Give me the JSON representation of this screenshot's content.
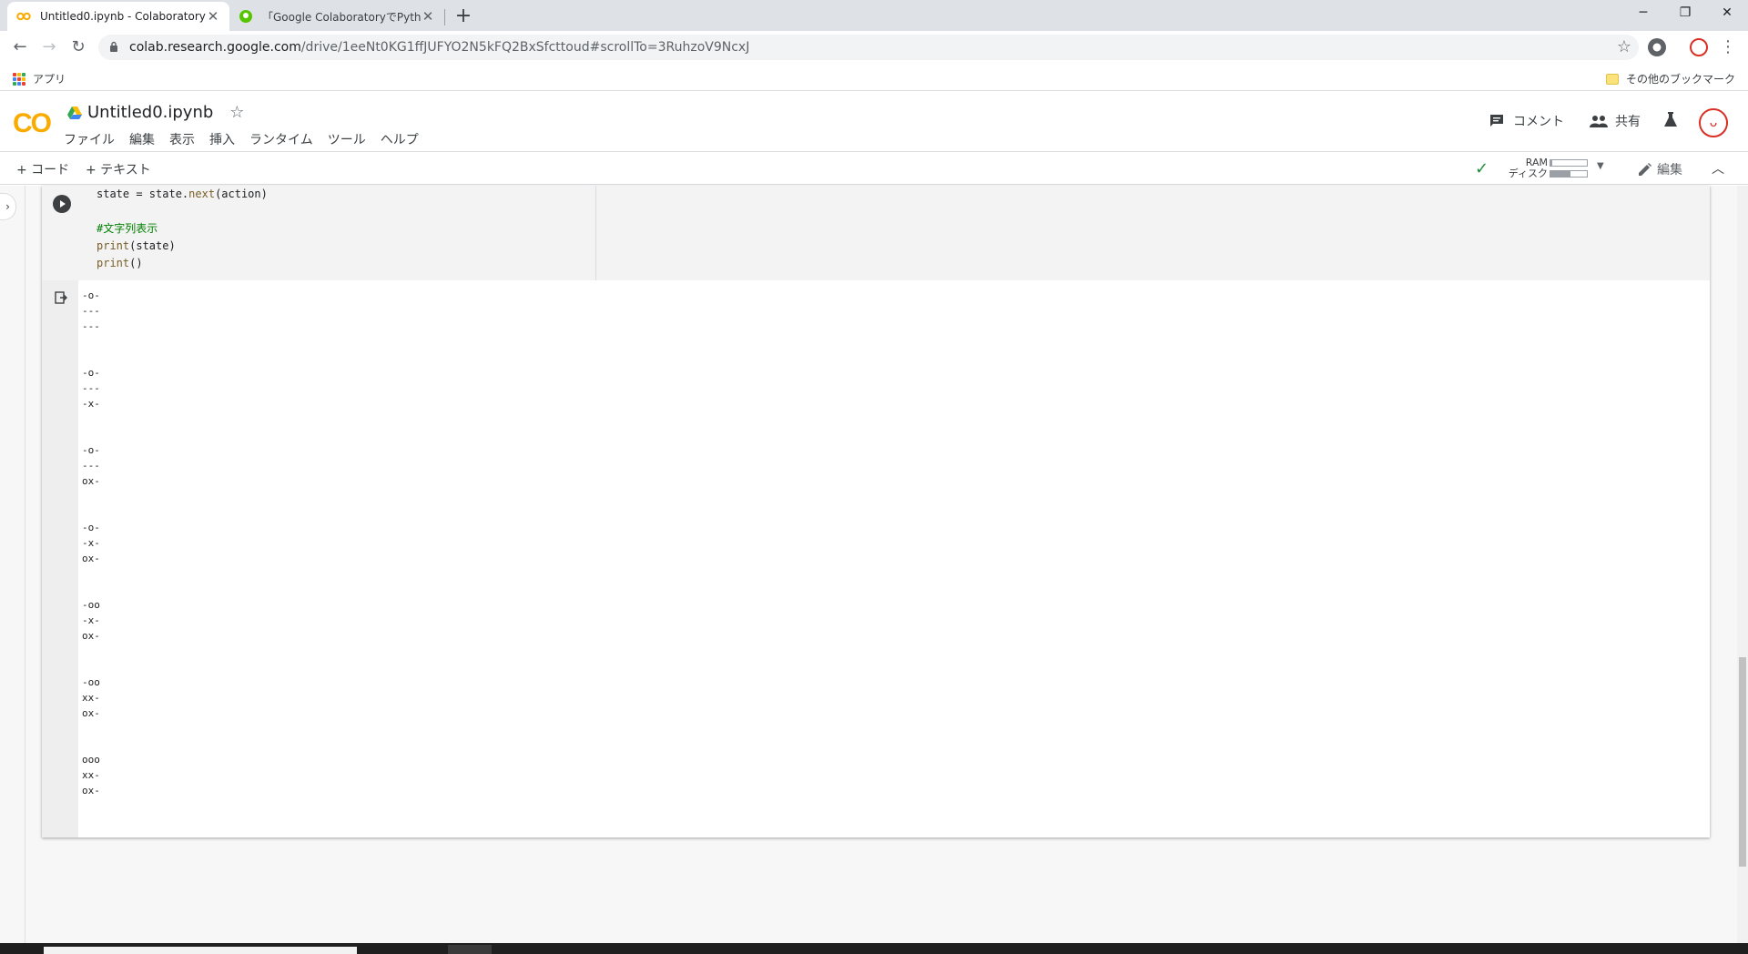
{
  "browser": {
    "tabs": [
      {
        "title": "Untitled0.ipynb - Colaboratory",
        "active": true
      },
      {
        "title": "「Google ColaboratoryでPython作",
        "active": false
      }
    ],
    "url_host": "colab.research.google.com",
    "url_path": "/drive/1eeNt0KG1ffJUFYO2N5kFQ2BxSfcttoud#scrollTo=3RuhzoV9NcxJ",
    "bookmarks": {
      "apps": "アプリ",
      "other": "その他のブックマーク"
    }
  },
  "colab": {
    "logo": "CO",
    "notebook_title": "Untitled0.ipynb",
    "menu": [
      "ファイル",
      "編集",
      "表示",
      "挿入",
      "ランタイム",
      "ツール",
      "ヘルプ"
    ],
    "comment": "コメント",
    "share": "共有",
    "avatar_initial": "ᴗ"
  },
  "toolbar": {
    "add_code": "+ コード",
    "add_text": "+ テキスト",
    "ram_label": "RAM",
    "disk_label": "ディスク",
    "ram_fraction": 0.05,
    "disk_fraction": 0.55,
    "edit": "編集"
  },
  "cell": {
    "code_lines": [
      {
        "type": "plain",
        "text": "state = state.",
        "fn": "next",
        "rest": "(action)"
      },
      {
        "type": "blank",
        "text": ""
      },
      {
        "type": "comment",
        "text": "#文字列表示"
      },
      {
        "type": "call",
        "fn": "print",
        "rest": "(state)"
      },
      {
        "type": "call",
        "fn": "print",
        "rest": "()"
      }
    ],
    "output": "-o-\n---\n---\n\n\n-o-\n---\n-x-\n\n\n-o-\n---\nox-\n\n\n-o-\n-x-\nox-\n\n\n-oo\n-x-\nox-\n\n\n-oo\nxx-\nox-\n\n\nooo\nxx-\nox-"
  },
  "colors": {
    "colab_orange": "#f9ab00",
    "check_green": "#1e8e3e",
    "comment_green": "#008000"
  }
}
